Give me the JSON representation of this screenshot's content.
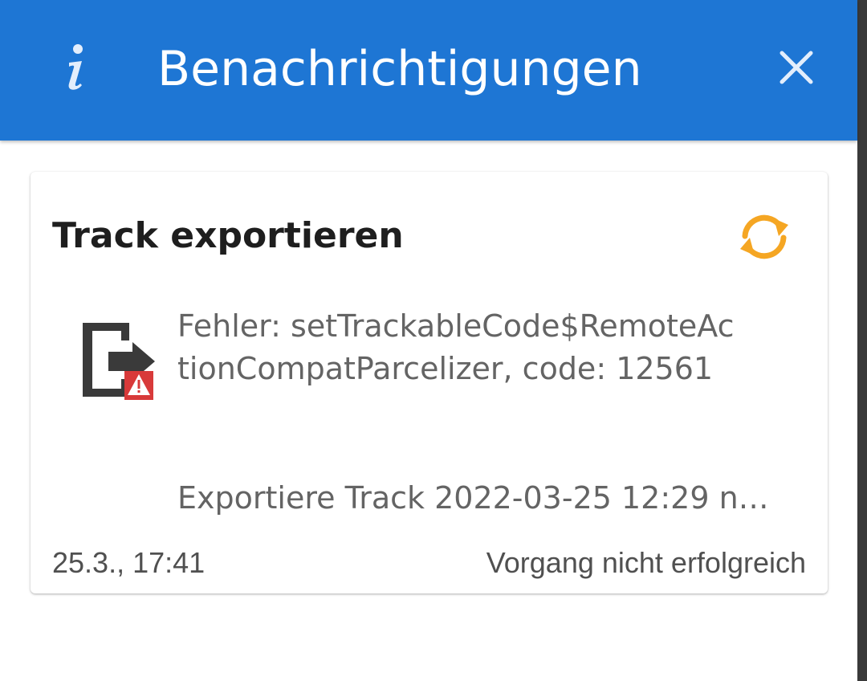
{
  "header": {
    "title": "Benachrichtigungen",
    "info_icon": "info-icon",
    "close_icon": "close-icon",
    "background_color": "#1e76d4"
  },
  "notification": {
    "title": "Track exportieren",
    "status_icon": "sync-icon",
    "status_icon_color": "#f5a623",
    "type_icon": "export-error-icon",
    "message": "Fehler: setTrackableCode$RemoteActionCompatParcelizer, code: 12561",
    "detail": "Exportiere Track 2022-03-25 12:29 n…",
    "timestamp": "25.3., 17:41",
    "status_text": "Vorgang nicht erfolgreich",
    "error_badge_color": "#d83a3a"
  }
}
